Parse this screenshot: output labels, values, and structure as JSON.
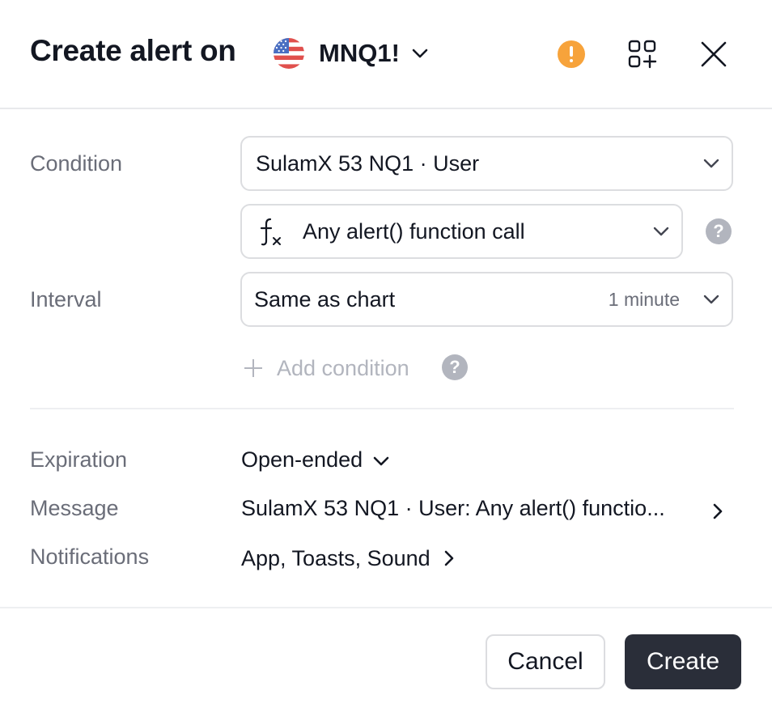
{
  "header": {
    "title": "Create alert on",
    "symbol": "MNQ1!",
    "flag_icon": "us-flag-icon",
    "warning_icon": "warning-icon",
    "add_layout_icon": "grid-add-icon",
    "close_icon": "close-icon"
  },
  "condition": {
    "label": "Condition",
    "source": "SulamX 53 NQ1 · User",
    "function_icon": "fx-icon",
    "trigger": "Any alert() function call"
  },
  "interval": {
    "label": "Interval",
    "value": "Same as chart",
    "sub_value": "1 minute"
  },
  "add_condition": {
    "label": "Add condition"
  },
  "expiration": {
    "label": "Expiration",
    "value": "Open-ended"
  },
  "message": {
    "label": "Message",
    "value": "SulamX 53 NQ1 · User: Any alert() functio..."
  },
  "notifications": {
    "label": "Notifications",
    "value": "App, Toasts, Sound"
  },
  "footer": {
    "cancel_label": "Cancel",
    "create_label": "Create"
  },
  "colors": {
    "warning": "#f7a33b",
    "primary_button": "#2a2e39",
    "help_icon": "#b2b5be",
    "muted_text": "#6a6d78"
  }
}
